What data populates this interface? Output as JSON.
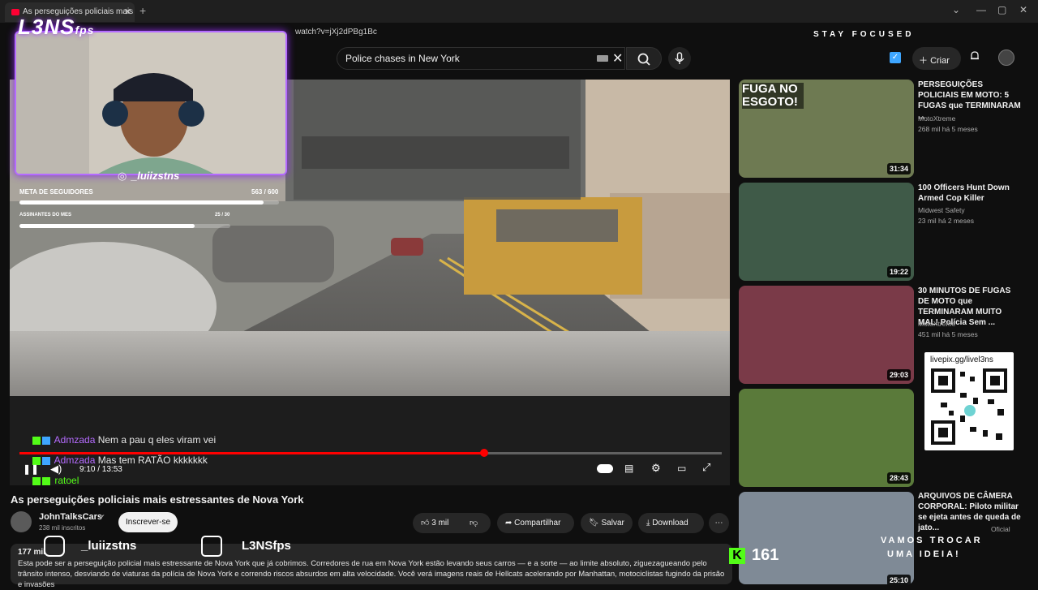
{
  "browser": {
    "tab_title": "As perseguições policiais mais",
    "url": "watch?v=jXj2dPBg1Bc"
  },
  "search": {
    "query": "Police chases in New York"
  },
  "header": {
    "create_label": "Criar"
  },
  "overlay": {
    "logo": "L3NS",
    "logo_suffix": "fps",
    "stay_focused": "STAY FOCUSED",
    "instagram_handle": "_luiizstns",
    "goal_followers_label": "META DE SEGUIDORES",
    "goal_followers_value": "563 / 600",
    "goal_followers_fraction": 0.94,
    "goal_subs_label": "ASSINANTES DO MES",
    "goal_subs_value": "25 / 30",
    "goal_subs_fraction": 0.83,
    "social_instagram": "_luiizstns",
    "social_youtube": "L3NSfps",
    "kick_viewers": "161",
    "trocar_line1": "VAMOS TROCAR",
    "trocar_line2": "UMA IDEIA!",
    "livepix_url": "livepix.gg/livel3ns"
  },
  "chat": [
    {
      "user": "Admzada",
      "message": "Nem a pau q eles viram vei"
    },
    {
      "user": "Admzada",
      "message": "Mas tem RATÃO kkkkkkk"
    },
    {
      "user": "ratoel",
      "message": ""
    }
  ],
  "player": {
    "time": "9:10 / 13:53",
    "progress": 0.66
  },
  "video": {
    "title": "As perseguições policiais mais estressantes de Nova York",
    "channel": "JohnTalksCars",
    "subscribers": "238 mil inscritos",
    "subscribe_label": "Inscrever-se",
    "likes": "3 mil",
    "share_label": "Compartilhar",
    "save_label": "Salvar",
    "download_label": "Download",
    "views": "177 mil",
    "description": "Esta pode ser a perseguição policial mais estressante de Nova York que já cobrimos. Corredores de rua em Nova York estão levando seus carros — e a sorte — ao limite absoluto, ziguezagueando pelo trânsito intenso, desviando de viaturas da polícia de Nova York e correndo riscos absurdos em alta velocidade. Você verá imagens reais de Hellcats acelerando por Manhattan, motociclistas fugindo da prisão e invasões"
  },
  "recommendations": [
    {
      "title": "PERSEGUIÇÕES POLICIAIS EM MOTO: 5 FUGAS que TERMINARAM ...",
      "channel": "MotoXtreme",
      "meta": "268 mil  há 5 meses",
      "duration": "31:34",
      "thumb_text": "FUGA NO ESGOTO!",
      "thumb_color": "#6e7a52"
    },
    {
      "title": "100 Officers Hunt Down Armed Cop Killer",
      "channel": "Midwest Safety",
      "meta": "23 mil  há 2 meses",
      "duration": "19:22",
      "thumb_text": "",
      "thumb_color": "#3f5a48"
    },
    {
      "title": "30 MINUTOS DE FUGAS DE MOTO que TERMINARAM MUITO MAL! Polícia Sem ...",
      "channel": "MotoXtreme",
      "meta": "451 mil  há 5 meses",
      "duration": "29:03",
      "thumb_text": "",
      "thumb_color": "#7a3a48"
    },
    {
      "title": "",
      "channel": "",
      "meta": "",
      "duration": "28:43",
      "thumb_text": "",
      "thumb_color": "#5a7a3a"
    },
    {
      "title": "ARQUIVOS DE CÂMERA CORPORAL: Piloto militar se ejeta antes de queda de jato...",
      "channel": "Oficial",
      "meta": "",
      "duration": "25:10",
      "thumb_text": "",
      "thumb_color": "#7f8a96"
    }
  ]
}
